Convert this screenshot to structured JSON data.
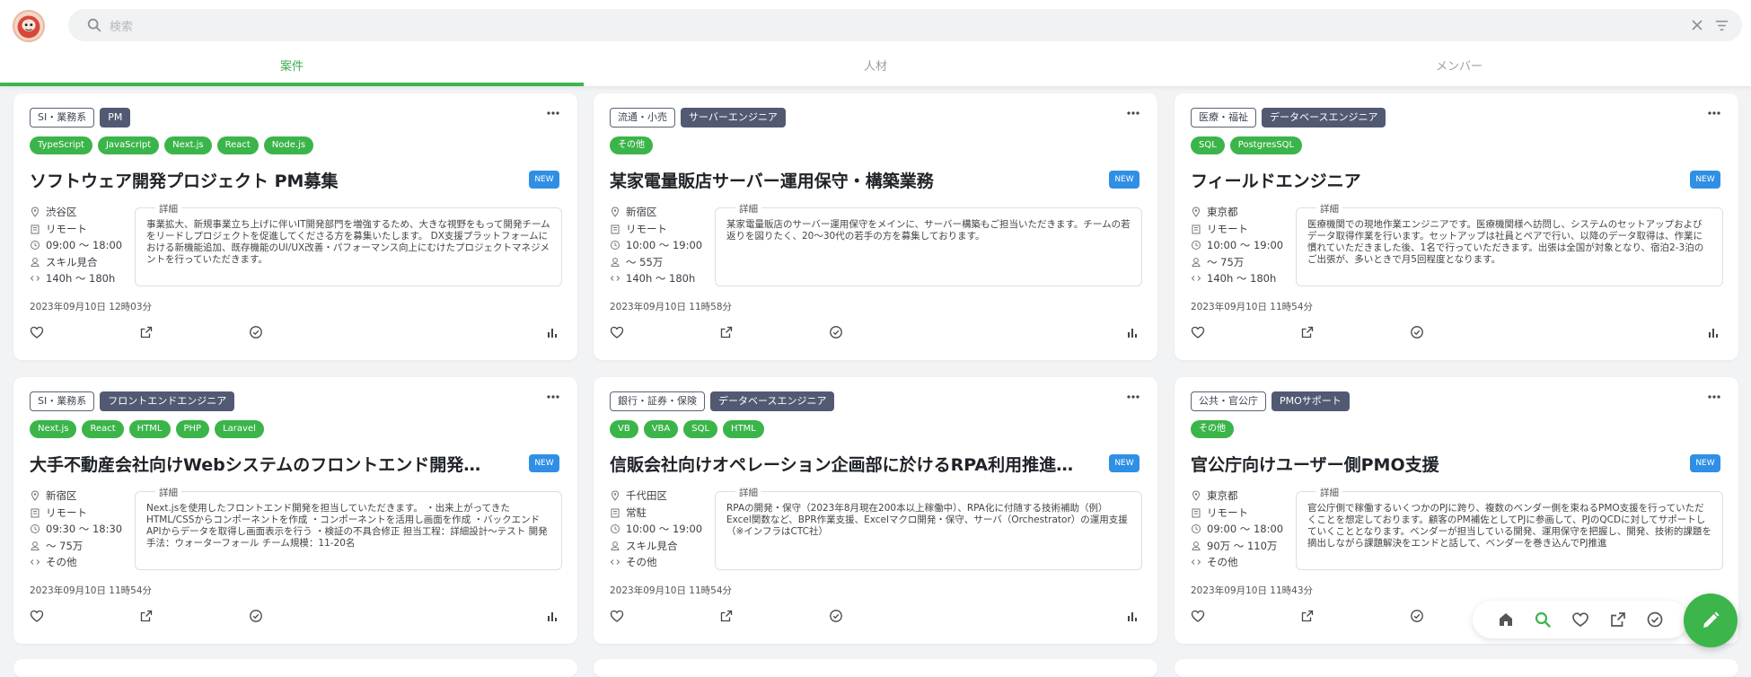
{
  "search": {
    "placeholder": "検索"
  },
  "tabs": [
    {
      "label": "案件",
      "active": true
    },
    {
      "label": "人材",
      "active": false
    },
    {
      "label": "メンバー",
      "active": false
    }
  ],
  "colors": {
    "accent": "#3cb54b",
    "new_badge": "#2f8fe5",
    "role_tag": "#525a73"
  },
  "detail_label": "詳細",
  "new_label": "NEW",
  "cards": [
    {
      "industry": "SI・業務系",
      "role": "PM",
      "skills": [
        "TypeScript",
        "JavaScript",
        "Next.js",
        "React",
        "Node.js"
      ],
      "title": "ソフトウェア開発プロジェクト PM募集",
      "location": "渋谷区",
      "workstyle": "リモート",
      "hours": "09:00 〜 18:00",
      "price": "スキル見合",
      "workload": "140h 〜 180h",
      "detail": "事業拡大、新規事業立ち上げに伴いIT開発部門を増強するため、大きな視野をもって開発チームをリードしプロジェクトを促進してくださる方を募集いたします。 DX支援プラットフォームにおける新機能追加、既存機能のUI/UX改善・パフォーマンス向上にむけたプロジェクトマネジメントを行っていただきます。",
      "date": "2023年09月10日 12時03分"
    },
    {
      "industry": "流通・小売",
      "role": "サーバーエンジニア",
      "skills": [
        "その他"
      ],
      "title": "某家電量販店サーバー運用保守・構築業務",
      "location": "新宿区",
      "workstyle": "リモート",
      "hours": "10:00 〜 19:00",
      "price": "〜 55万",
      "workload": "140h 〜 180h",
      "detail": "某家電量販店のサーバー運用保守をメインに、サーバー構築もご担当いただきます。チームの若返りを図りたく、20〜30代の若手の方を募集しております。",
      "date": "2023年09月10日 11時58分"
    },
    {
      "industry": "医療・福祉",
      "role": "データベースエンジニア",
      "skills": [
        "SQL",
        "PostgresSQL"
      ],
      "title": "フィールドエンジニア",
      "location": "東京都",
      "workstyle": "リモート",
      "hours": "10:00 〜 19:00",
      "price": "〜 75万",
      "workload": "140h 〜 180h",
      "detail": "医療機関での現地作業エンジニアです。医療機関様へ訪問し、システムのセットアップおよびデータ取得作業を行います。セットアップは社員とペアで行い、以降のデータ取得は、作業に慣れていただきました後、1名で行っていただきます。出張は全国が対象となり、宿泊2-3泊のご出張が、多いときで月5回程度となります。",
      "date": "2023年09月10日 11時54分"
    },
    {
      "industry": "SI・業務系",
      "role": "フロントエンドエンジニア",
      "skills": [
        "Next.js",
        "React",
        "HTML",
        "PHP",
        "Laravel"
      ],
      "title": "大手不動産会社向けWebシステムのフロントエンド開発支援",
      "location": "新宿区",
      "workstyle": "リモート",
      "hours": "09:30 〜 18:30",
      "price": "〜 75万",
      "workload": "その他",
      "detail": "Next.jsを使用したフロントエンド開発を担当していただきます。 ・出来上がってきたHTML/CSSからコンポーネントを作成 ・コンポーネントを活用し画面を作成 ・バックエンドAPIからデータを取得し画面表示を行う ・検証の不具合修正 担当工程：詳細設計〜テスト 開発手法：ウォーターフォール チーム規模：11-20名",
      "date": "2023年09月10日 11時54分"
    },
    {
      "industry": "銀行・証券・保険",
      "role": "データベースエンジニア",
      "skills": [
        "VB",
        "VBA",
        "SQL",
        "HTML"
      ],
      "title": "信販会社向けオペレーション企画部に於けるRPA利用推進支援",
      "location": "千代田区",
      "workstyle": "常駐",
      "hours": "10:00 〜 19:00",
      "price": "スキル見合",
      "workload": "その他",
      "detail": "RPAの開発・保守（2023年8月現在200本以上稼働中）、RPA化に付随する技術補助（例）Excel関数など、BPR作業支援、Excelマクロ開発・保守、サーバ（Orchestrator）の運用支援（※インフラはCTC社）",
      "date": "2023年09月10日 11時54分"
    },
    {
      "industry": "公共・官公庁",
      "role": "PMOサポート",
      "skills": [
        "その他"
      ],
      "title": "官公庁向けユーザー側PMO支援",
      "location": "東京都",
      "workstyle": "リモート",
      "hours": "09:00 〜 18:00",
      "price": "90万 〜 110万",
      "workload": "その他",
      "detail": "官公庁側で稼働するいくつかのPJに跨り、複数のベンダー側を束ねるPMO支援を行っていただくことを想定しております。顧客のPM補佐としてPJに参画して、PJのQCDに対してサポートしていくこととなります。ベンダーが担当している開発、運用保守を把握し、開発、技術的課題を摘出しながら課題解決をエンドと話して、ベンダーを巻き込んでPJ推進",
      "date": "2023年09月10日 11時43分"
    }
  ],
  "float_nav": [
    "home-icon",
    "search-icon",
    "heart-icon",
    "share-icon",
    "check-circle-icon"
  ],
  "fab": "edit-icon"
}
